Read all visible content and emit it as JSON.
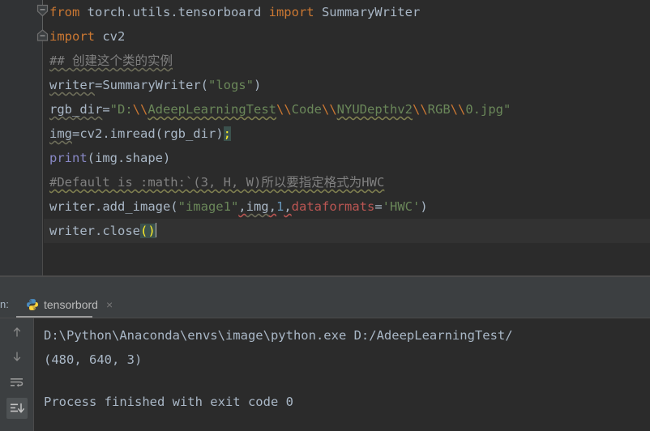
{
  "window": {
    "background": "#2B2B2B",
    "panel_background": "#3C3F41"
  },
  "editor": {
    "fold_markers": [
      {
        "name": "fold-marker-shield",
        "line": 1
      },
      {
        "name": "fold-marker-house",
        "line": 2
      }
    ],
    "lines": [
      {
        "index": 1,
        "tokens": [
          {
            "text": "from",
            "style": "kw"
          },
          {
            "text": " torch.utils.tensorboard ",
            "style": "id"
          },
          {
            "text": "import",
            "style": "kw"
          },
          {
            "text": " SummaryWriter",
            "style": "id"
          }
        ]
      },
      {
        "index": 2,
        "tokens": [
          {
            "text": "import",
            "style": "kw"
          },
          {
            "text": " cv2",
            "style": "id"
          }
        ]
      },
      {
        "index": 3,
        "tokens": [
          {
            "text": "## 创建这个类的实例",
            "style": "cmt wave-gray"
          }
        ]
      },
      {
        "index": 4,
        "tokens": [
          {
            "text": "writer",
            "style": "id wave-gray"
          },
          {
            "text": "=SummaryWriter(",
            "style": "id"
          },
          {
            "text": "\"logs\"",
            "style": "str"
          },
          {
            "text": ")",
            "style": "id"
          }
        ]
      },
      {
        "index": 5,
        "tokens": [
          {
            "text": "rgb_dir",
            "style": "id wave-gray"
          },
          {
            "text": "=",
            "style": "id"
          },
          {
            "text": "\"D:",
            "style": "str"
          },
          {
            "text": "\\\\",
            "style": "esc"
          },
          {
            "text": "AdeepLearningTest",
            "style": "str wave-g"
          },
          {
            "text": "\\\\",
            "style": "esc"
          },
          {
            "text": "Code",
            "style": "str"
          },
          {
            "text": "\\\\",
            "style": "esc"
          },
          {
            "text": "NYUDepthv2",
            "style": "str wave-g"
          },
          {
            "text": "\\\\",
            "style": "esc"
          },
          {
            "text": "RGB",
            "style": "str"
          },
          {
            "text": "\\\\",
            "style": "esc"
          },
          {
            "text": "0.jpg\"",
            "style": "str"
          }
        ]
      },
      {
        "index": 6,
        "tokens": [
          {
            "text": "img",
            "style": "id wave-gray"
          },
          {
            "text": "=cv2.imread(rgb_dir)",
            "style": "id"
          },
          {
            "text": ";",
            "style": "brk"
          }
        ]
      },
      {
        "index": 7,
        "tokens": [
          {
            "text": "print",
            "style": "builtin"
          },
          {
            "text": "(img.shape)",
            "style": "id"
          }
        ]
      },
      {
        "index": 8,
        "tokens": [
          {
            "text": "#Default is :math:`(3, H, W)所以要指定格式为HWC",
            "style": "cmt wave-g"
          }
        ]
      },
      {
        "index": 9,
        "tokens": [
          {
            "text": "writer.add_image(",
            "style": "id"
          },
          {
            "text": "\"image1\"",
            "style": "str"
          },
          {
            "text": ",",
            "style": "id wave-r"
          },
          {
            "text": "img",
            "style": "id wave-gray"
          },
          {
            "text": ",",
            "style": "id wave-r"
          },
          {
            "text": "1",
            "style": "num"
          },
          {
            "text": ",",
            "style": "id wave-r"
          },
          {
            "text": "dataformats",
            "style": "err"
          },
          {
            "text": "=",
            "style": "id"
          },
          {
            "text": "'HWC'",
            "style": "str"
          },
          {
            "text": ")",
            "style": "id"
          }
        ]
      },
      {
        "index": 10,
        "current": true,
        "tokens": [
          {
            "text": "writer.close",
            "style": "id"
          },
          {
            "text": "()",
            "style": "brk"
          }
        ],
        "caret": true
      }
    ]
  },
  "run_panel": {
    "label": "n:",
    "tab": {
      "icon": "python-icon",
      "label": "tensorbord",
      "close": "×"
    },
    "toolbar": [
      {
        "name": "scroll-up-button",
        "icon": "arrow-up-icon",
        "active": false
      },
      {
        "name": "scroll-down-button",
        "icon": "arrow-down-icon",
        "active": false
      },
      {
        "name": "soft-wrap-button",
        "icon": "soft-wrap-icon",
        "active": false
      },
      {
        "name": "scroll-to-end-button",
        "icon": "scroll-to-end-icon",
        "active": true
      }
    ],
    "console_lines": [
      "D:\\Python\\Anaconda\\envs\\image\\python.exe D:/AdeepLearningTest/",
      "(480, 640, 3)",
      "",
      "Process finished with exit code 0"
    ]
  }
}
